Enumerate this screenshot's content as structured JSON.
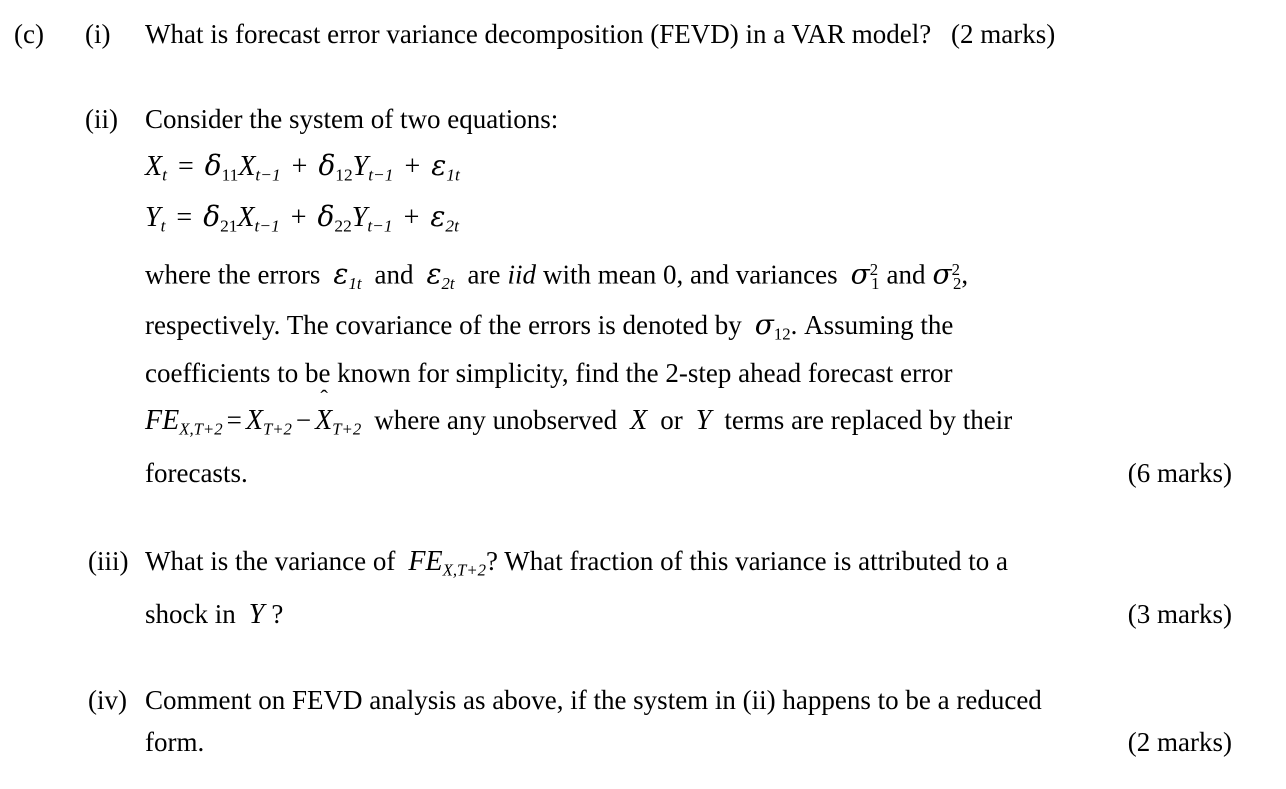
{
  "document": {
    "type": "exam-question",
    "background_color": "#ffffff",
    "text_color": "#000000"
  },
  "part_label": "(c)",
  "questions": [
    {
      "number": "(i)",
      "text": "What is forecast error variance decomposition (FEVD) in a VAR model?",
      "marks": "(2 marks)"
    },
    {
      "number": "(ii)",
      "intro": "Consider the system of two equations:",
      "equations": [
        {
          "lhs_var": "X",
          "lhs_sub": "t",
          "eq": "=",
          "terms": [
            {
              "coef": "δ",
              "coef_sub": "11",
              "var": "X",
              "var_sub": "t−1"
            },
            {
              "op": "+",
              "coef": "δ",
              "coef_sub": "12",
              "var": "Y",
              "var_sub": "t−1"
            },
            {
              "op": "+",
              "coef": "ε",
              "coef_sub": "1t"
            }
          ]
        },
        {
          "lhs_var": "Y",
          "lhs_sub": "t",
          "eq": "=",
          "terms": [
            {
              "coef": "δ",
              "coef_sub": "21",
              "var": "X",
              "var_sub": "t−1"
            },
            {
              "op": "+",
              "coef": "δ",
              "coef_sub": "22",
              "var": "Y",
              "var_sub": "t−1"
            },
            {
              "op": "+",
              "coef": "ε",
              "coef_sub": "2t"
            }
          ]
        }
      ],
      "line_where_1": "where the errors",
      "eps1": "ε",
      "eps1_sub": "1t",
      "line_where_2": "and",
      "eps2": "ε",
      "eps2_sub": "2t",
      "line_where_3": "are",
      "iid": "iid",
      "line_where_4": "with mean 0, and variances",
      "sigma1": "σ",
      "sigma1_sub": "1",
      "sigma1_sup": "2",
      "line_where_5": "and",
      "sigma2": "σ",
      "sigma2_sub": "2",
      "sigma2_sup": "2",
      "line_where_6": ",",
      "line_resp_1": "respectively.  The covariance of the errors is denoted by",
      "sigma12": "σ",
      "sigma12_sub": "12",
      "line_resp_2": ".  Assuming the",
      "line_coef": "coefficients to be known for simplicity, find the 2-step ahead forecast error",
      "fe_symbol": "FE",
      "fe_sub": "X,T+2",
      "fe_eq": "=",
      "fe_x1": "X",
      "fe_x1_sub": "T+2",
      "fe_minus": "−",
      "fe_x2": "X",
      "fe_x2_hat": "ˆ",
      "fe_x2_sub": "T+2",
      "fe_tail_1": "where any unobserved",
      "var_x": "X",
      "fe_tail_2": "or",
      "var_y": "Y",
      "fe_tail_3": "terms are replaced by their",
      "last_line": "forecasts.",
      "marks": "(6 marks)"
    },
    {
      "number": "(iii)",
      "text_1": "What is the variance of",
      "fe_symbol": "FE",
      "fe_sub": "X,T+2",
      "text_2": "?  What fraction of this variance is attributed to a",
      "text_3": "shock in",
      "var_y": "Y",
      "text_4": "?",
      "marks": "(3 marks)"
    },
    {
      "number": "(iv)",
      "text_1": "Comment on FEVD analysis as above, if the system in (ii) happens to be a reduced",
      "text_2": "form.",
      "marks": "(2 marks)"
    }
  ]
}
